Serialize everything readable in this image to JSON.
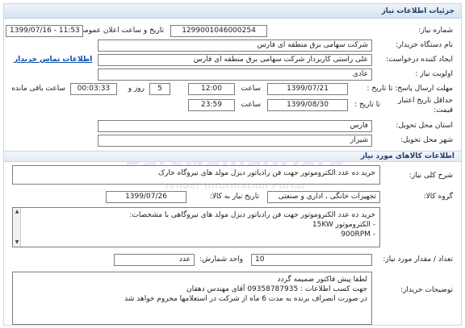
{
  "header": {
    "title": "جزئیات اطلاعات نیاز"
  },
  "need_number": {
    "label": "شماره نیاز:",
    "value": "1299001046000254"
  },
  "announce": {
    "label": "تاریخ و ساعت اعلان عمومی:",
    "value": "1399/07/16 - 11:53"
  },
  "buyer_org": {
    "label": "نام دستگاه خریدار:",
    "value": "شرکت سهامی برق منطقه ای فارس"
  },
  "creator": {
    "label": "ایجاد کننده درخواست:",
    "value": "علی راستی کاربرداز شرکت سهامی برق منطقه ای فارس",
    "contact_link": "اطلاعات تماس خریدار"
  },
  "priority": {
    "label": "اولویت نیاز :",
    "value": "عادی"
  },
  "reply_deadline": {
    "label": "مهلت ارسال پاسخ: تا تاریخ :",
    "date": "1399/07/21",
    "time_label": "ساعت",
    "time": "12:00",
    "days": "5",
    "days_label": "روز و",
    "remaining": "00:03:33",
    "remaining_label": "ساعت باقی مانده"
  },
  "price_validity": {
    "label1": "حداقل تاریخ اعتبار",
    "label2": "قیمت:",
    "until_label": "تا تاریخ :",
    "date": "1399/08/30",
    "time_label": "ساعت",
    "time": "23:59"
  },
  "province": {
    "label": "استان محل تحویل:",
    "value": "فارس"
  },
  "city": {
    "label": "شهر محل تحویل:",
    "value": "شیراز"
  },
  "goods_section": {
    "title": "اطلاعات کالاهای مورد نیاز"
  },
  "general_desc": {
    "label": "شرح کلی نیاز:",
    "value": "خرید ده عدد الکتروموتور جهت فن رادیاتور دیزل مولد های نیروگاه خارک"
  },
  "goods_group": {
    "label": "گروه کالا:",
    "value": "تجهیزات خانگی ، اداری و صنعتی",
    "need_date_label": "تاریخ نیاز به کالا:",
    "need_date": "1399/07/26"
  },
  "goods_list": {
    "lines": [
      "خرید ده عدد الکتروموتور جهت فن رادیاتور دیزل مولد های نیروگاهی با مشخصات:",
      "- الکتروموتور 15KW",
      "- 900RPM"
    ]
  },
  "quantity": {
    "label": "تعداد / مقدار مورد نیاز:",
    "value": "10",
    "unit_label": "واحد شمارش:",
    "unit": "عدد"
  },
  "buyer_notes": {
    "label": "توضیحات خریدار:",
    "lines": [
      "لطفا پیش فاکتور ضمیمه گردد",
      "جهت کسب اطلاعات : 09358787935 آقای مهندس دهقان",
      "در صورت انصراف برنده به مدت 6 ماه از شرکت در استعلامها محروم خواهد شد"
    ]
  },
  "watermark": {
    "main": "ParsNamadData",
    "sub": "Tender Information Portal"
  }
}
